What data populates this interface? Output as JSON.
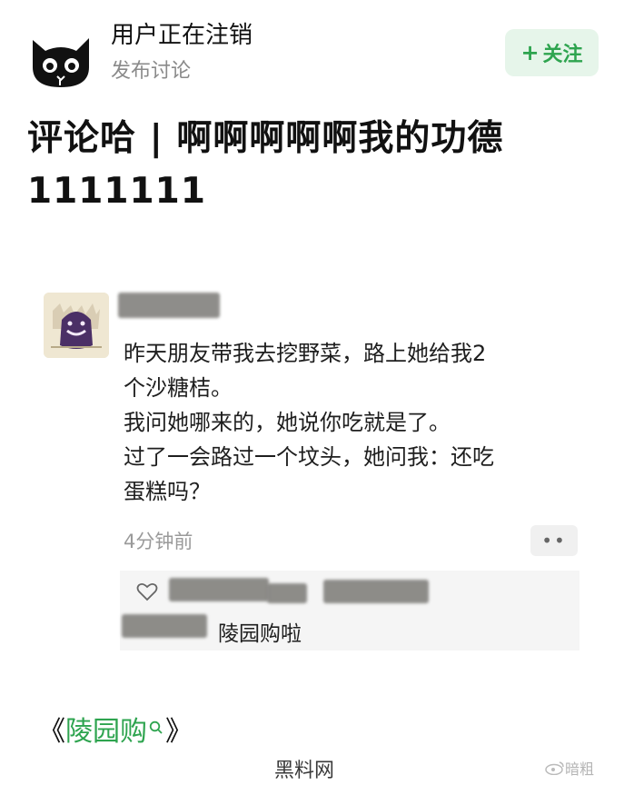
{
  "header": {
    "username": "用户正在注销",
    "subtitle": "发布讨论",
    "follow_plus": "+",
    "follow_label": "关注"
  },
  "post": {
    "title_line1": "评论哈 | 啊啊啊啊啊我的功德",
    "title_line2": "1111111"
  },
  "comment": {
    "lines": [
      "昨天朋友带我去挖野菜，路上她给我2",
      "个沙糖桔。",
      "我问她哪来的，她说你吃就是了。",
      "过了一会路过一个坟头，她问我：还吃",
      "蛋糕吗？"
    ],
    "time": "4分钟前",
    "more": "••",
    "reply_text": "陵园购啦"
  },
  "footer": {
    "open_bracket": "《",
    "keyword": "陵园购",
    "close_bracket": "》"
  },
  "watermarks": {
    "center": "黑料网",
    "right": "暗粗"
  },
  "colors": {
    "accent_green": "#2ea44f",
    "follow_bg": "#e6f5ea",
    "muted_text": "#8a8a8a"
  }
}
